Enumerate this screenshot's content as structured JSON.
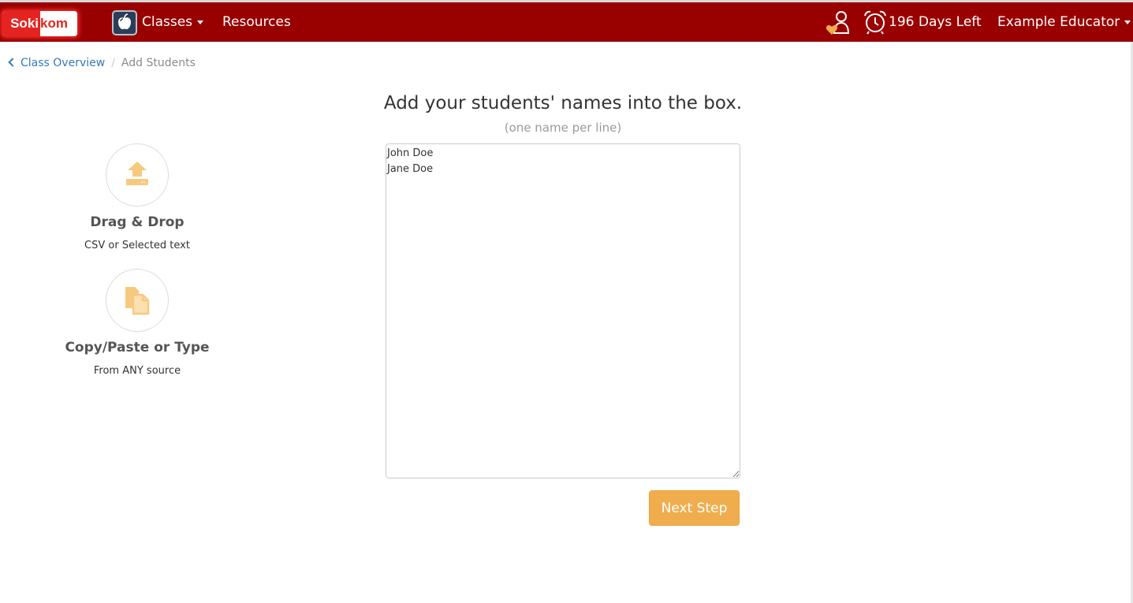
{
  "navbar": {
    "logo": {
      "part1": "Soki",
      "part2": "kom"
    },
    "classes_label": "Classes",
    "resources_label": "Resources",
    "days_left": "196 Days Left",
    "user_name": "Example Educator"
  },
  "breadcrumb": {
    "back_label": "Class Overview",
    "separator": "/",
    "current": "Add Students"
  },
  "features": [
    {
      "icon": "upload-icon",
      "title": "Drag & Drop",
      "subtitle": "CSV or Selected text"
    },
    {
      "icon": "copy-paste-icon",
      "title": "Copy/Paste or Type",
      "subtitle": "From ANY source"
    }
  ],
  "main": {
    "heading": "Add your students' names into the box.",
    "subheading": "(one name per line)",
    "names_value": "John Doe\nJane Doe",
    "next_label": "Next Step"
  },
  "colors": {
    "navbar": "#990000",
    "accent": "#f0ad4e",
    "link": "#337ab7",
    "icon": "#f7c97f"
  }
}
